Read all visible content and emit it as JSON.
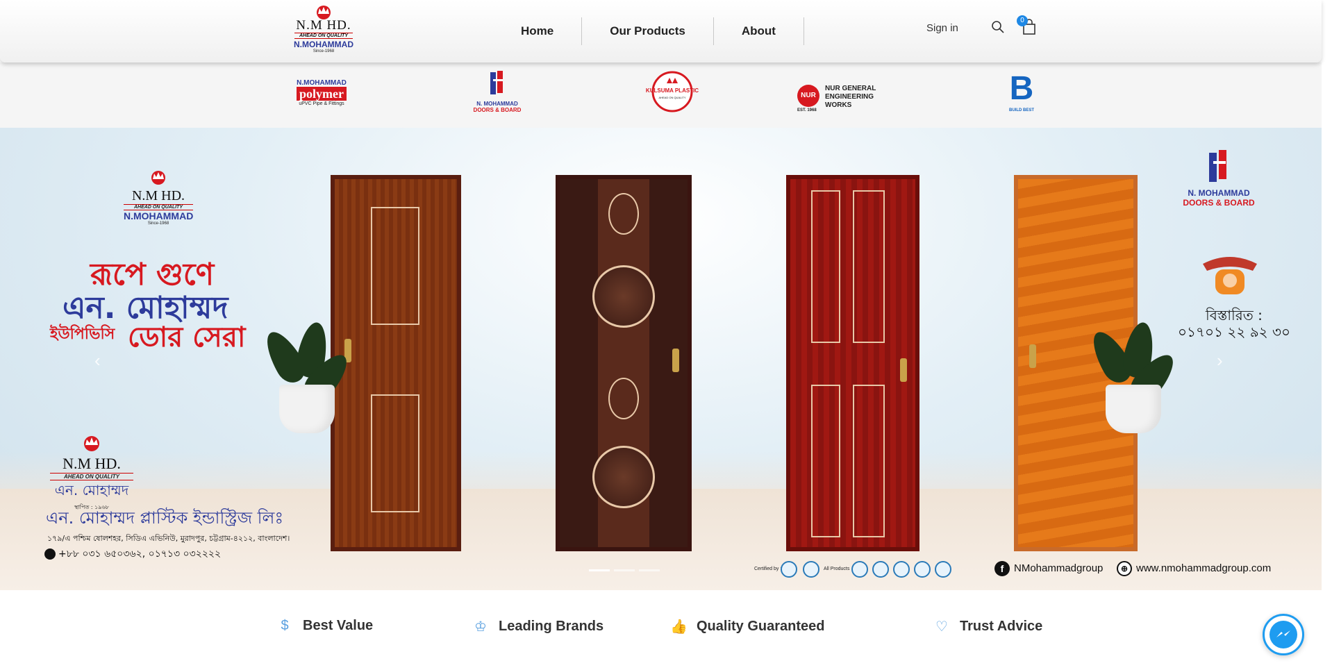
{
  "header": {
    "logo": {
      "mark": "N.M HD.",
      "tagline": "AHEAD ON QUALITY",
      "name": "N.MOHAMMAD",
      "since": "Since-1968"
    },
    "nav": [
      "Home",
      "Our Products",
      "About"
    ],
    "signin": "Sign in",
    "cart_count": "0"
  },
  "brands": {
    "polymer": {
      "t1": "N.MOHAMMAD",
      "t2": "polymer",
      "t3": "uPVC Pipe & Fittings"
    },
    "doors": {
      "t1": "N. MOHAMMAD",
      "t2": "DOORS & BOARD"
    },
    "kulsuma": {
      "t1": "KULSUMA PLASTIC",
      "t2": "AHEAD ON QUALITY"
    },
    "nur": {
      "mark": "NUR",
      "t1": "NUR GENERAL",
      "t2": "ENGINEERING",
      "t3": "WORKS",
      "est": "EST. 1968"
    },
    "buildbest": {
      "mark": "B",
      "t": "BUILD BEST"
    }
  },
  "hero": {
    "logo": {
      "mark": "N.M HD.",
      "tagline": "AHEAD ON QUALITY",
      "name": "N.MOHAMMAD",
      "since": "Since-1968"
    },
    "headline1": "রূপে গুণে",
    "headline2": "এন. মোহাম্মদ",
    "headline3a": "ইউপিভিসি",
    "headline3b": "ডোর সেরা",
    "company_logo": {
      "mark": "N.M HD.",
      "tagline": "AHEAD ON QUALITY",
      "bname": "এন. মোহাম্মদ",
      "since": "স্থাপিত : ১৯৬৮"
    },
    "company_name": "এন. মোহাম্মদ প্লাস্টিক ইন্ডাস্ট্রিজ লিঃ",
    "address": "১৭৯/এ পশ্চিম ষোলশহর, সিডিএ এভিনিউ, মুরাদপুর, চট্টগ্রাম-৪২১২, বাংলাদেশ।",
    "phone": "+৮৮ ০৩১ ৬৫০৩৬২, ০১৭১৩ ০৩২২২২",
    "doors_logo": {
      "t1": "N. MOHAMMAD",
      "t2": "DOORS & BOARD"
    },
    "contact_label": "বিস্তারিত :",
    "contact_number": "০১৭০১ ২২ ৯২ ৩০",
    "certified_label": "Certified by :",
    "all_products_label": "All Products",
    "facebook": "NMohammadgroup",
    "website": "www.nmohammadgroup.com"
  },
  "features": [
    "Best Value",
    "Leading Brands",
    "Quality Guaranteed",
    "Trust Advice"
  ],
  "icons": {
    "prev": "‹",
    "next": "›",
    "feature_icons": [
      "$",
      "♔",
      "👍",
      "♡"
    ]
  }
}
